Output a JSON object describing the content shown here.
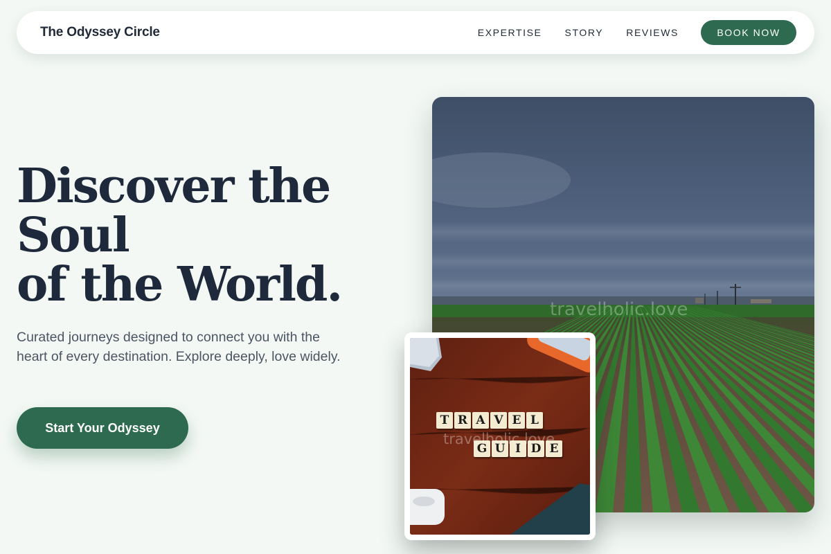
{
  "nav": {
    "brand": "The Odyssey Circle",
    "links": [
      "EXPERTISE",
      "STORY",
      "REVIEWS"
    ],
    "book_label": "BOOK NOW"
  },
  "hero": {
    "headline_lines": [
      "Discover the",
      "Soul",
      "of the World."
    ],
    "subtext": "Curated journeys designed to connect you with the heart of every destination. Explore deeply, love widely.",
    "cta_label": "Start Your Odyssey"
  },
  "main_image": {
    "subject": "cloudy sky over green crop field rows",
    "watermark": "travelholic.love"
  },
  "inset_image": {
    "subject": "letter tiles on wooden table",
    "tiles_line1": [
      "T",
      "R",
      "A",
      "V",
      "E",
      "L"
    ],
    "tiles_line2": [
      "G",
      "U",
      "I",
      "D",
      "E"
    ],
    "watermark": "travelholic.love"
  },
  "colors": {
    "accent": "#2d6a4f",
    "background": "#f3f8f4",
    "heading": "#1e293b"
  }
}
